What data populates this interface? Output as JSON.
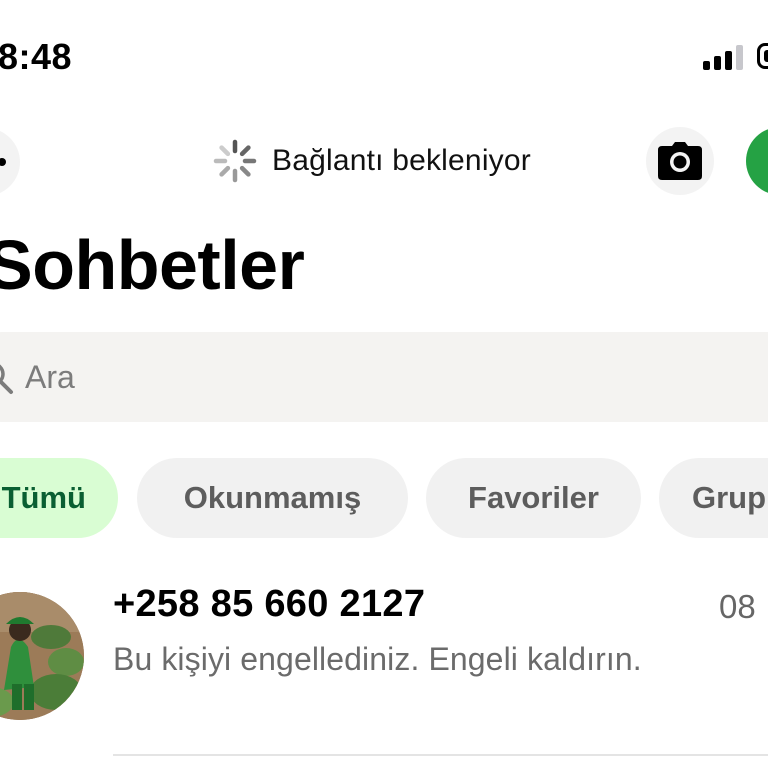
{
  "status_bar": {
    "time": "8:48"
  },
  "header": {
    "connection_status": "Bağlantı bekleniyor",
    "title": "Sohbetler"
  },
  "search": {
    "placeholder": "Ara",
    "value": ""
  },
  "filters": [
    {
      "label": "Tümü",
      "active": true
    },
    {
      "label": "Okunmamış",
      "active": false
    },
    {
      "label": "Favoriler",
      "active": false
    },
    {
      "label": "Grup",
      "active": false
    }
  ],
  "chats": [
    {
      "name": "+258 85 660 2127",
      "time": "08",
      "preview": "Bu kişiyi engellediniz. Engeli kaldırın."
    }
  ],
  "icons": {
    "more": "more-icon",
    "spinner": "spinner-icon",
    "camera": "camera-icon",
    "new_chat": "new-chat-icon",
    "search": "search-icon"
  },
  "colors": {
    "accent_green": "#25a244",
    "active_chip_bg": "#d9fdd3",
    "active_chip_text": "#0a5f32",
    "chip_bg": "#f1f1f1",
    "search_bg": "#f4f3f1"
  }
}
